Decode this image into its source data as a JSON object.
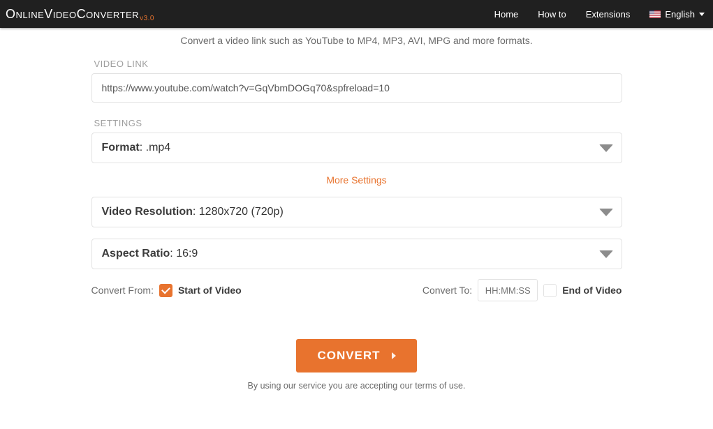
{
  "header": {
    "logo_text": "OnlineVideoConverter",
    "version": "v3.0",
    "nav": {
      "home": "Home",
      "howto": "How to",
      "extensions": "Extensions"
    },
    "language_label": "English"
  },
  "subtitle": {
    "prefix": "Convert a video ",
    "link_word": "link",
    "suffix": " such as YouTube to MP4, MP3, AVI, MPG and more formats."
  },
  "video_link": {
    "label": "VIDEO LINK",
    "value": "https://www.youtube.com/watch?v=GqVbmDOGq70&spfreload=10"
  },
  "settings": {
    "label": "SETTINGS",
    "format": {
      "bold": "Format",
      "rest": ": .mp4"
    },
    "more_settings": "More Settings",
    "resolution": {
      "bold": "Video Resolution",
      "rest": ": 1280x720 (720p)"
    },
    "aspect": {
      "bold": "Aspect Ratio",
      "rest": ": 16:9"
    }
  },
  "convert_range": {
    "from_label": "Convert From:",
    "start_of_video": "Start of Video",
    "to_label": "Convert To:",
    "time_placeholder": "HH:MM:SS",
    "end_of_video": "End of Video"
  },
  "convert_button": "CONVERT",
  "terms_text": "By using our service you are accepting our terms of use."
}
